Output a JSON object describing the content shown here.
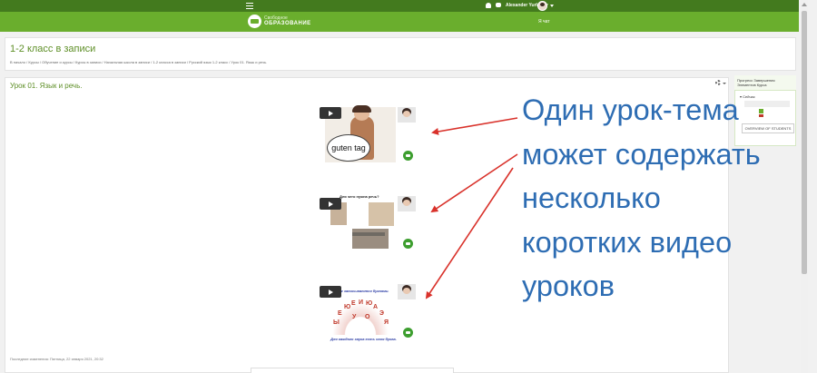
{
  "topbar": {
    "user_name": "Alexander Yurlanov"
  },
  "brand": {
    "logo_line1": "Свободное",
    "logo_line2": "ОБРАЗОВАНИЕ",
    "right_link": "Я чат"
  },
  "page": {
    "title": "1-2 класс в записи",
    "breadcrumbs": [
      "В начало",
      "Курсы",
      "Обучение и курсы",
      "Курсы в записи",
      "Начальная школа в записи",
      "1-2 класса в записи",
      "Русский язык 1-2 класс",
      "Урок 01. Язык и речь."
    ],
    "breadcrumb_text": "В начало  /  Курсы  /  Обучение и курсы  /  Курсы в записи  /  Начальная школа в записи  /  1-2 класса в записи  /  Русский язык 1-2 класс  /  Урок 01. Язык и речь."
  },
  "lesson": {
    "title": "Урок 01. Язык и речь.",
    "last_modified": "Последние изменения: Пятница, 22 января 2021, 20:32"
  },
  "videos": [
    {
      "caption": "guten tag"
    },
    {
      "caption": "Для чего нужна речь?"
    },
    {
      "caption": "Как записываются буквами.",
      "subcaption": "Для каждого звука есть своя буква.",
      "letters": [
        "Ы",
        "Е",
        "Ю",
        "Е",
        "И",
        "Ю",
        "А",
        "Э",
        "Я",
        "У",
        "О"
      ]
    }
  ],
  "side_block": {
    "title": "Прогресс Завершения Элементов Курса",
    "list_label": "▾ Сейчас",
    "overview_button": "OVERVIEW OF STUDENTS"
  },
  "annotation": {
    "lines": [
      "Один урок-тема",
      "может содержать",
      "несколько",
      "коротких видео",
      "уроков"
    ],
    "color": "#2e6db3"
  },
  "colors": {
    "topbar": "#437a1e",
    "brandbar": "#6aae2d",
    "accent_text": "#5e8f27",
    "arrow": "#d9322b"
  }
}
